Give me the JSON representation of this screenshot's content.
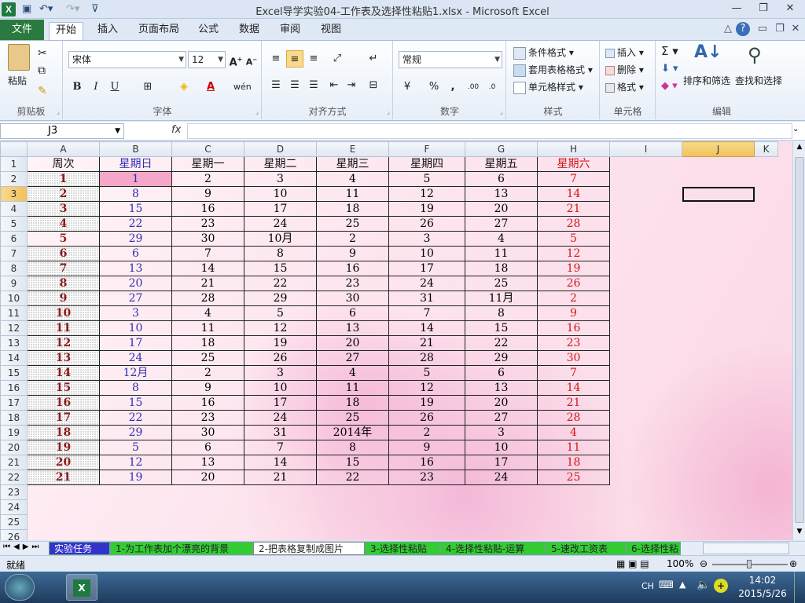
{
  "app": {
    "title": "Excel导学实验04-工作表及选择性粘贴1.xlsx - Microsoft Excel",
    "file_tab": "文件",
    "tabs": [
      "开始",
      "插入",
      "页面布局",
      "公式",
      "数据",
      "审阅",
      "视图"
    ]
  },
  "ribbon": {
    "clipboard": {
      "paste": "粘贴",
      "label": "剪贴板"
    },
    "font": {
      "name": "宋体",
      "size": "12",
      "label": "字体"
    },
    "alignment": {
      "label": "对齐方式"
    },
    "number": {
      "format": "常规",
      "label": "数字"
    },
    "styles": {
      "conditional": "条件格式",
      "table": "套用表格格式",
      "cell": "单元格样式",
      "label": "样式"
    },
    "cells": {
      "insert": "插入",
      "delete": "删除",
      "format": "格式",
      "label": "单元格"
    },
    "editing": {
      "sort": "排序和筛选",
      "find": "查找和选择",
      "label": "编辑"
    }
  },
  "formula_bar": {
    "name_box": "J3",
    "fx": "fx",
    "formula": ""
  },
  "sheet": {
    "columns": [
      "A",
      "B",
      "C",
      "D",
      "E",
      "F",
      "G",
      "H",
      "I",
      "J"
    ],
    "selected_col": "J",
    "selected_row": "3",
    "row_numbers": [
      "1",
      "2",
      "3",
      "4",
      "5",
      "6",
      "7",
      "8",
      "9",
      "10",
      "11",
      "12",
      "13",
      "14",
      "15",
      "16",
      "17",
      "18",
      "19",
      "20",
      "21",
      "22",
      "23",
      "24",
      "25",
      "26"
    ],
    "rows": [
      [
        "周次",
        "星期日",
        "星期一",
        "星期二",
        "星期三",
        "星期四",
        "星期五",
        "星期六"
      ],
      [
        "1",
        "1",
        "2",
        "3",
        "4",
        "5",
        "6",
        "7"
      ],
      [
        "2",
        "8",
        "9",
        "10",
        "11",
        "12",
        "13",
        "14"
      ],
      [
        "3",
        "15",
        "16",
        "17",
        "18",
        "19",
        "20",
        "21"
      ],
      [
        "4",
        "22",
        "23",
        "24",
        "25",
        "26",
        "27",
        "28"
      ],
      [
        "5",
        "29",
        "30",
        "10月",
        "2",
        "3",
        "4",
        "5"
      ],
      [
        "6",
        "6",
        "7",
        "8",
        "9",
        "10",
        "11",
        "12"
      ],
      [
        "7",
        "13",
        "14",
        "15",
        "16",
        "17",
        "18",
        "19"
      ],
      [
        "8",
        "20",
        "21",
        "22",
        "23",
        "24",
        "25",
        "26"
      ],
      [
        "9",
        "27",
        "28",
        "29",
        "30",
        "31",
        "11月",
        "2"
      ],
      [
        "10",
        "3",
        "4",
        "5",
        "6",
        "7",
        "8",
        "9"
      ],
      [
        "11",
        "10",
        "11",
        "12",
        "13",
        "14",
        "15",
        "16"
      ],
      [
        "12",
        "17",
        "18",
        "19",
        "20",
        "21",
        "22",
        "23"
      ],
      [
        "13",
        "24",
        "25",
        "26",
        "27",
        "28",
        "29",
        "30"
      ],
      [
        "14",
        "12月",
        "2",
        "3",
        "4",
        "5",
        "6",
        "7"
      ],
      [
        "15",
        "8",
        "9",
        "10",
        "11",
        "12",
        "13",
        "14"
      ],
      [
        "16",
        "15",
        "16",
        "17",
        "18",
        "19",
        "20",
        "21"
      ],
      [
        "17",
        "22",
        "23",
        "24",
        "25",
        "26",
        "27",
        "28"
      ],
      [
        "18",
        "29",
        "30",
        "31",
        "2014年",
        "2",
        "3",
        "4"
      ],
      [
        "19",
        "5",
        "6",
        "7",
        "8",
        "9",
        "10",
        "11"
      ],
      [
        "20",
        "12",
        "13",
        "14",
        "15",
        "16",
        "17",
        "18"
      ],
      [
        "21",
        "19",
        "20",
        "21",
        "22",
        "23",
        "24",
        "25"
      ]
    ]
  },
  "sheet_tabs": [
    {
      "label": "实验任务",
      "color": "#3333cc"
    },
    {
      "label": "1-为工作表加个漂亮的背景",
      "color": "#33cc33"
    },
    {
      "label": "2-把表格复制成图片",
      "color": "#ffffff",
      "active": true
    },
    {
      "label": "3-选择性粘贴",
      "color": "#33cc33"
    },
    {
      "label": "4-选择性粘贴-运算",
      "color": "#33cc33"
    },
    {
      "label": "5-速改工资表",
      "color": "#33cc33"
    },
    {
      "label": "6-选择性粘",
      "color": "#33cc33"
    }
  ],
  "status": {
    "mode": "就绪",
    "zoom": "100%"
  },
  "taskbar": {
    "lang": "CH",
    "time": "14:02",
    "date": "2015/5/26"
  }
}
